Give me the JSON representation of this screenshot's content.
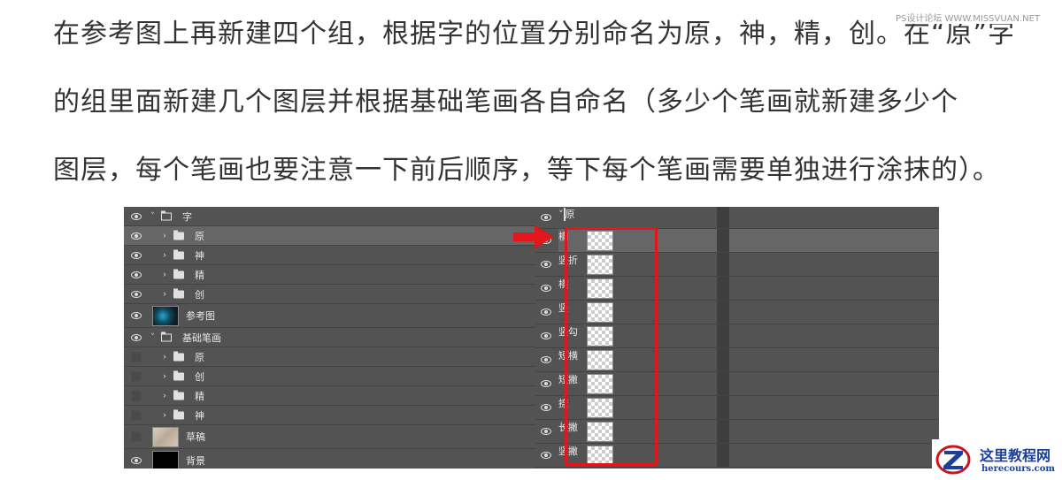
{
  "paragraph": {
    "line1": "在参考图上再新建四个组，根据字的位置分别命名为原，神，精，创。在“原”字",
    "line2": "的组里面新建几个图层并根据基础笔画各自命名（多少个笔画就新建多少个",
    "line3": "图层，每个笔画也要注意一下前后顺序，等下每个笔画需要单独进行涂抹的）。"
  },
  "watermark_top": "PS设计论坛 WWW.MISSVUAN.NET",
  "left_panel": {
    "rows": [
      {
        "label": "字",
        "type": "group-open",
        "visible": true,
        "indent": 0
      },
      {
        "label": "原",
        "type": "group-closed",
        "visible": true,
        "indent": 1,
        "selected": true
      },
      {
        "label": "神",
        "type": "group-closed",
        "visible": true,
        "indent": 1
      },
      {
        "label": "精",
        "type": "group-closed",
        "visible": true,
        "indent": 1
      },
      {
        "label": "创",
        "type": "group-closed",
        "visible": true,
        "indent": 1
      },
      {
        "label": "参考图",
        "type": "layer",
        "thumb": "ref",
        "visible": true
      },
      {
        "label": "基础笔画",
        "type": "group-open",
        "visible": true,
        "indent": 0
      },
      {
        "label": "原",
        "type": "group-closed",
        "visible": false,
        "indent": 1
      },
      {
        "label": "创",
        "type": "group-closed",
        "visible": false,
        "indent": 1
      },
      {
        "label": "精",
        "type": "group-closed",
        "visible": false,
        "indent": 1
      },
      {
        "label": "神",
        "type": "group-closed",
        "visible": false,
        "indent": 1
      },
      {
        "label": "草稿",
        "type": "layer",
        "thumb": "draft",
        "visible": false
      },
      {
        "label": "背景",
        "type": "layer",
        "thumb": "black",
        "visible": true
      }
    ]
  },
  "right_panel": {
    "group_label": "原",
    "layers": [
      {
        "label": "横",
        "selected": true
      },
      {
        "label": "竖折"
      },
      {
        "label": "横"
      },
      {
        "label": "竖"
      },
      {
        "label": "竖勾"
      },
      {
        "label": "短横"
      },
      {
        "label": "短撇"
      },
      {
        "label": "捺"
      },
      {
        "label": "长撇"
      },
      {
        "label": "竖撇"
      }
    ]
  },
  "colors": {
    "panel_bg": "#535353",
    "highlight": "#e3161b",
    "logo_blue": "#1a3f9c"
  },
  "logo": {
    "title": "这里教程网",
    "url": "herecours.com"
  }
}
